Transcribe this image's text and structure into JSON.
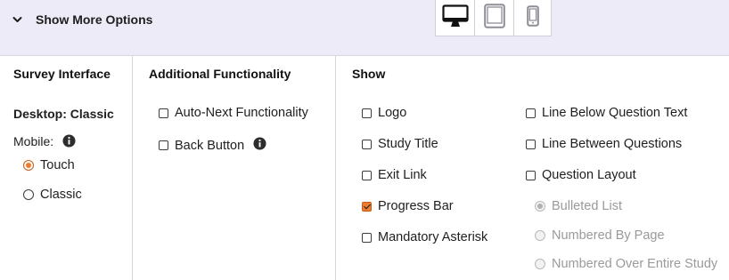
{
  "header": {
    "toggle_label": "Show More Options",
    "devices": [
      {
        "name": "desktop",
        "active": true
      },
      {
        "name": "tablet",
        "active": false
      },
      {
        "name": "mobile",
        "active": false
      }
    ]
  },
  "survey_interface": {
    "heading": "Survey Interface",
    "desktop_label": "Desktop: Classic",
    "mobile_label": "Mobile:",
    "mobile_options": [
      {
        "label": "Touch",
        "selected": true
      },
      {
        "label": "Classic",
        "selected": false
      }
    ]
  },
  "additional_functionality": {
    "heading": "Additional Functionality",
    "options": [
      {
        "label": "Auto-Next Functionality",
        "checked": false
      },
      {
        "label": "Back Button",
        "checked": false
      }
    ]
  },
  "show": {
    "heading": "Show",
    "left_options": [
      {
        "label": "Logo",
        "checked": false
      },
      {
        "label": "Study Title",
        "checked": false
      },
      {
        "label": "Exit Link",
        "checked": false
      },
      {
        "label": "Progress Bar",
        "checked": true
      },
      {
        "label": "Mandatory Asterisk",
        "checked": false
      }
    ],
    "right_options": [
      {
        "label": "Line Below Question Text",
        "checked": false
      },
      {
        "label": "Line Between Questions",
        "checked": false
      },
      {
        "label": "Question Layout",
        "checked": false
      }
    ],
    "layout_options": [
      {
        "label": "Bulleted List",
        "selected": true,
        "disabled": true
      },
      {
        "label": "Numbered By Page",
        "selected": false,
        "disabled": true
      },
      {
        "label": "Numbered Over Entire Study",
        "selected": false,
        "disabled": true
      }
    ]
  },
  "colors": {
    "accent": "#ef7b2f",
    "header_bg": "#ecebf7",
    "divider": "#d6d6d6"
  }
}
